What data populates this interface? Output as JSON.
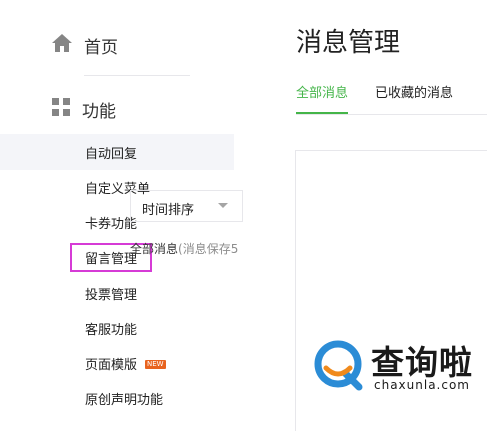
{
  "sidebar": {
    "home": {
      "label": "首页",
      "icon": "home-icon"
    },
    "function": {
      "label": "功能",
      "icon": "grid-icon"
    },
    "items": [
      {
        "label": "自动回复"
      },
      {
        "label": "自定义菜单"
      },
      {
        "label": "卡券功能"
      },
      {
        "label": "留言管理"
      },
      {
        "label": "投票管理"
      },
      {
        "label": "客服功能"
      },
      {
        "label": "页面模版",
        "badge": "NEW"
      },
      {
        "label": "原创声明功能"
      }
    ]
  },
  "main": {
    "title": "消息管理",
    "tabs": [
      {
        "label": "全部消息"
      },
      {
        "label": "已收藏的消息"
      }
    ],
    "sort": {
      "value": "时间排序"
    },
    "count": {
      "label": "全部消息",
      "hint": "(消息保存5"
    }
  },
  "watermark": {
    "text_cn": "查询啦",
    "text_en": "chaxunla.com"
  },
  "colors": {
    "accent_green": "#44b549",
    "highlight_border": "#d63bd6",
    "badge_orange": "#e8631f",
    "watermark_blue": "#2b8cd6",
    "watermark_orange": "#f08a1c"
  }
}
